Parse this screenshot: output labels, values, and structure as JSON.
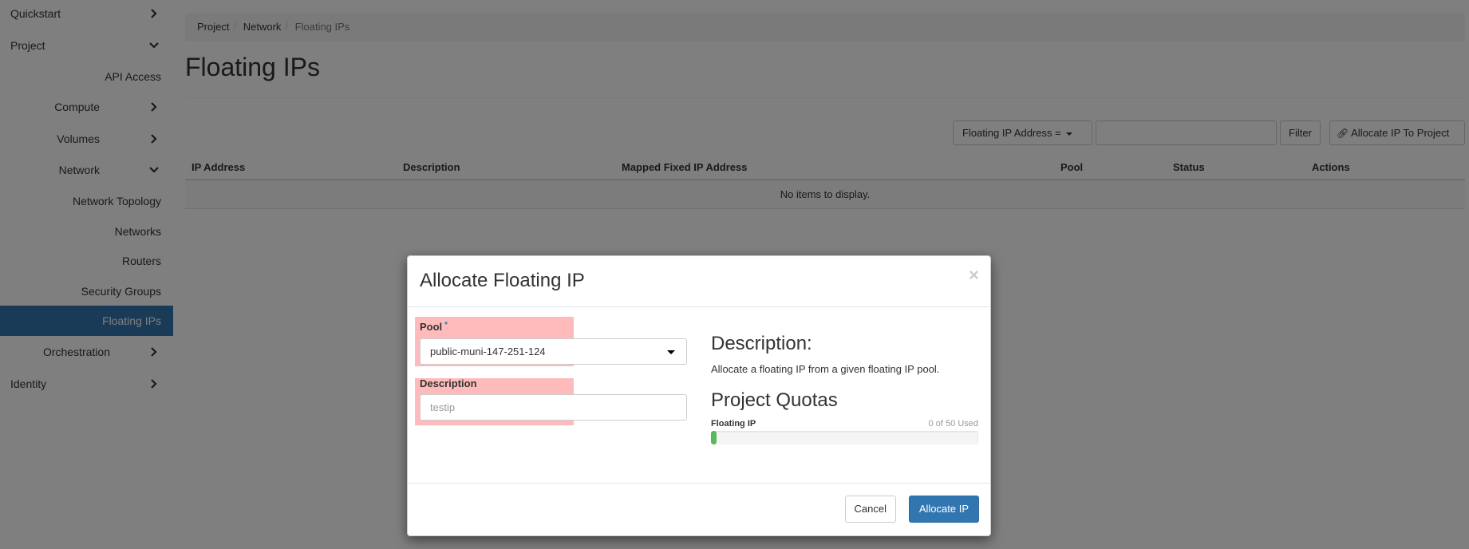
{
  "sidebar": {
    "items": [
      {
        "label": "Quickstart",
        "chevron": "right"
      },
      {
        "label": "Project",
        "chevron": "down"
      },
      {
        "label": "API Access"
      },
      {
        "label": "Compute",
        "chevron": "right"
      },
      {
        "label": "Volumes",
        "chevron": "right"
      },
      {
        "label": "Network",
        "chevron": "down"
      },
      {
        "label": "Network Topology"
      },
      {
        "label": "Networks"
      },
      {
        "label": "Routers"
      },
      {
        "label": "Security Groups"
      },
      {
        "label": "Floating IPs",
        "active": true
      },
      {
        "label": "Orchestration",
        "chevron": "right"
      },
      {
        "label": "Identity",
        "chevron": "right"
      }
    ]
  },
  "breadcrumb": {
    "items": [
      "Project",
      "Network",
      "Floating IPs"
    ]
  },
  "page": {
    "title": "Floating IPs"
  },
  "toolbar": {
    "filter_field": "Floating IP Address =",
    "filter_value": "",
    "filter_button": "Filter",
    "allocate_button": "Allocate IP To Project"
  },
  "table": {
    "columns": [
      "IP Address",
      "Description",
      "Mapped Fixed IP Address",
      "Pool",
      "Status",
      "Actions"
    ],
    "empty_message": "No items to display."
  },
  "modal": {
    "title": "Allocate Floating IP",
    "close": "×",
    "pool_label": "Pool",
    "pool_required": "*",
    "pool_value": "public-muni-147-251-124",
    "description_label": "Description",
    "description_value": "testip",
    "help_title": "Description:",
    "help_text": "Allocate a floating IP from a given floating IP pool.",
    "quota_title": "Project Quotas",
    "quota_label": "Floating IP",
    "quota_used": "0 of 50 Used",
    "quota_fraction": 0.02,
    "cancel_button": "Cancel",
    "submit_button": "Allocate IP"
  },
  "colors": {
    "accent": "#3276b1",
    "progress": "#5cb85c",
    "highlight": "#ff7878"
  }
}
